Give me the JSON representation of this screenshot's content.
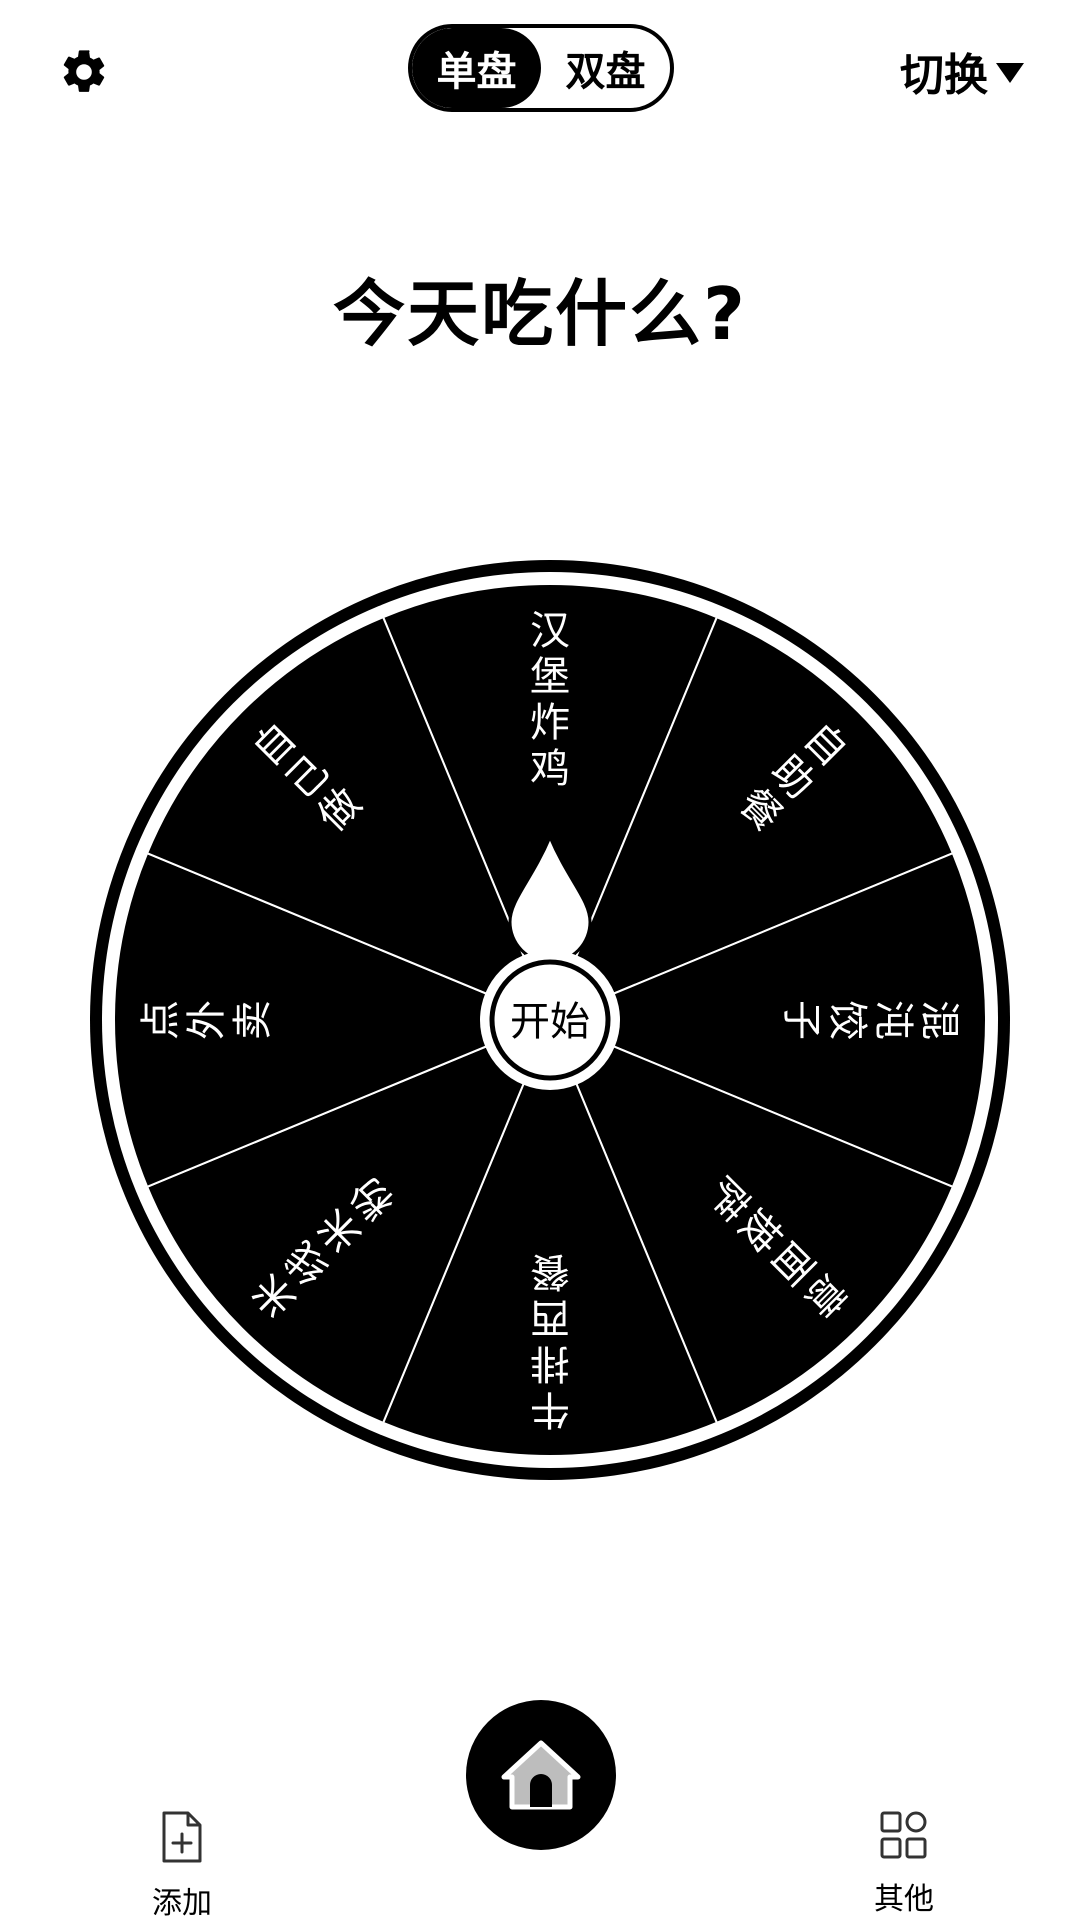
{
  "header": {
    "settings_icon": "gear-icon",
    "mode_tabs": [
      {
        "label": "单盘",
        "active": true
      },
      {
        "label": "双盘",
        "active": false
      }
    ],
    "switch_label": "切换",
    "switch_icon": "caret-down-icon"
  },
  "title": "今天吃什么?",
  "wheel": {
    "center_label": "开始",
    "segment_color": "#000000",
    "text_color": "#ffffff",
    "segments": [
      {
        "label": "汉堡炸鸡"
      },
      {
        "label": "自助餐"
      },
      {
        "label": "混沌饺子"
      },
      {
        "label": "意面披萨"
      },
      {
        "label": "牛排西餐"
      },
      {
        "label": "米线米粉"
      },
      {
        "label": "点外卖"
      },
      {
        "label": "自己做"
      }
    ]
  },
  "bottom_nav": {
    "add": {
      "label": "添加",
      "icon": "file-add-icon"
    },
    "home": {
      "icon": "home-icon"
    },
    "other": {
      "label": "其他",
      "icon": "grid-icon"
    }
  }
}
